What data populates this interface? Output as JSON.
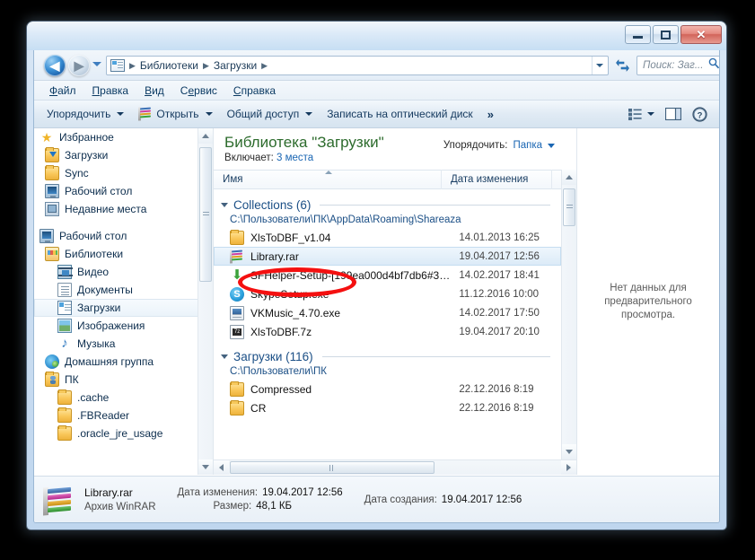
{
  "window": {
    "controls": {
      "minimize": "minimize-button",
      "maximize": "maximize-button",
      "close_glyph": "✕"
    }
  },
  "navbar": {
    "back_glyph": "◀",
    "forward_glyph": "▶",
    "breadcrumbs": [
      "Библиотеки",
      "Загрузки"
    ],
    "separator": "▶",
    "search_placeholder": "Поиск: Заг...",
    "search_value": ""
  },
  "menubar": {
    "items": [
      {
        "accel": "Ф",
        "rest": "айл"
      },
      {
        "accel": "П",
        "rest": "равка"
      },
      {
        "accel": "В",
        "rest": "ид"
      },
      {
        "accel": "С",
        "rest": "ервис",
        "pre": "С",
        "mid": "е"
      },
      {
        "accel": "С",
        "rest": "правка"
      }
    ],
    "labels": [
      "Файл",
      "Правка",
      "Вид",
      "Сервис",
      "Справка"
    ]
  },
  "commandbar": {
    "organize": "Упорядочить",
    "open": "Открыть",
    "share": "Общий доступ",
    "burn": "Записать на оптический диск",
    "overflow": "»",
    "view_label": "view-options",
    "pane_label": "preview-pane-toggle",
    "help_label": "?"
  },
  "navpane": {
    "items": [
      {
        "label": "Избранное",
        "icon": "star-icon",
        "indent": 0,
        "selected": false,
        "gap_before": false
      },
      {
        "label": "Загрузки",
        "icon": "folder-download-icon",
        "indent": 1,
        "selected": false,
        "gap_before": false
      },
      {
        "label": "Sync",
        "icon": "folder-icon",
        "indent": 1,
        "selected": false,
        "gap_before": false
      },
      {
        "label": "Рабочий стол",
        "icon": "desktop-icon",
        "indent": 1,
        "selected": false,
        "gap_before": false
      },
      {
        "label": "Недавние места",
        "icon": "recent-places-icon",
        "indent": 1,
        "selected": false,
        "gap_before": false
      },
      {
        "label": "Рабочий стол",
        "icon": "desktop-icon",
        "indent": 0,
        "selected": false,
        "gap_before": true
      },
      {
        "label": "Библиотеки",
        "icon": "libraries-icon",
        "indent": 1,
        "selected": false,
        "gap_before": false
      },
      {
        "label": "Видео",
        "icon": "video-library-icon",
        "indent": 2,
        "selected": false,
        "gap_before": false
      },
      {
        "label": "Документы",
        "icon": "documents-library-icon",
        "indent": 2,
        "selected": false,
        "gap_before": false
      },
      {
        "label": "Загрузки",
        "icon": "downloads-library-icon",
        "indent": 2,
        "selected": true,
        "gap_before": false
      },
      {
        "label": "Изображения",
        "icon": "pictures-library-icon",
        "indent": 2,
        "selected": false,
        "gap_before": false
      },
      {
        "label": "Музыка",
        "icon": "music-library-icon",
        "indent": 2,
        "selected": false,
        "gap_before": false
      },
      {
        "label": "Домашняя группа",
        "icon": "homegroup-icon",
        "indent": 1,
        "selected": false,
        "gap_before": false
      },
      {
        "label": "ПК",
        "icon": "user-folder-icon",
        "indent": 1,
        "selected": false,
        "gap_before": false
      },
      {
        "label": ".cache",
        "icon": "folder-icon",
        "indent": 2,
        "selected": false,
        "gap_before": false
      },
      {
        "label": ".FBReader",
        "icon": "folder-icon",
        "indent": 2,
        "selected": false,
        "gap_before": false
      },
      {
        "label": ".oracle_jre_usage",
        "icon": "folder-icon",
        "indent": 2,
        "selected": false,
        "gap_before": false
      }
    ]
  },
  "library": {
    "title": "Библиотека \"Загрузки\"",
    "includes_label": "Включает:",
    "includes_value": "3 места",
    "arrange_label": "Упорядочить:",
    "arrange_value": "Папка"
  },
  "columns": {
    "name": "Имя",
    "date_modified": "Дата изменения"
  },
  "groups": [
    {
      "title": "Collections (6)",
      "path": "C:\\Пользователи\\ПК\\AppData\\Roaming\\Shareaza",
      "rows": [
        {
          "name": "XlsToDBF_v1.04",
          "date": "14.01.2013 16:25",
          "icon": "folder-icon",
          "selected": false
        },
        {
          "name": "Library.rar",
          "date": "19.04.2017 12:56",
          "icon": "winrar-archive-icon",
          "selected": true
        },
        {
          "name": "SFHelper-Setup-[199ea000d4bf7db6#300...",
          "date": "14.02.2017 18:41",
          "icon": "green-arrow-installer-icon",
          "selected": false
        },
        {
          "name": "SkypeSetup.exe",
          "date": "11.12.2016 10:00",
          "icon": "skype-icon",
          "selected": false
        },
        {
          "name": "VKMusic_4.70.exe",
          "date": "14.02.2017 17:50",
          "icon": "exe-icon",
          "selected": false
        },
        {
          "name": "XlsToDBF.7z",
          "date": "19.04.2017 20:10",
          "icon": "sevenzip-archive-icon",
          "selected": false
        }
      ]
    },
    {
      "title": "Загрузки (116)",
      "path": "C:\\Пользователи\\ПК",
      "rows": [
        {
          "name": "Compressed",
          "date": "22.12.2016 8:19",
          "icon": "folder-icon",
          "selected": false
        },
        {
          "name": "CR",
          "date": "22.12.2016 8:19",
          "icon": "folder-icon",
          "selected": false
        }
      ]
    }
  ],
  "preview": {
    "message": "Нет данных для предварительного просмотра."
  },
  "details": {
    "file_name": "Library.rar",
    "file_type": "Архив WinRAR",
    "modified_label": "Дата изменения:",
    "modified_value": "19.04.2017 12:56",
    "size_label": "Размер:",
    "size_value": "48,1 КБ",
    "created_label": "Дата создания:",
    "created_value": "19.04.2017 12:56"
  },
  "annotation": {
    "type": "red-ellipse-highlight",
    "color": "#f41010",
    "target": "Library.rar"
  }
}
